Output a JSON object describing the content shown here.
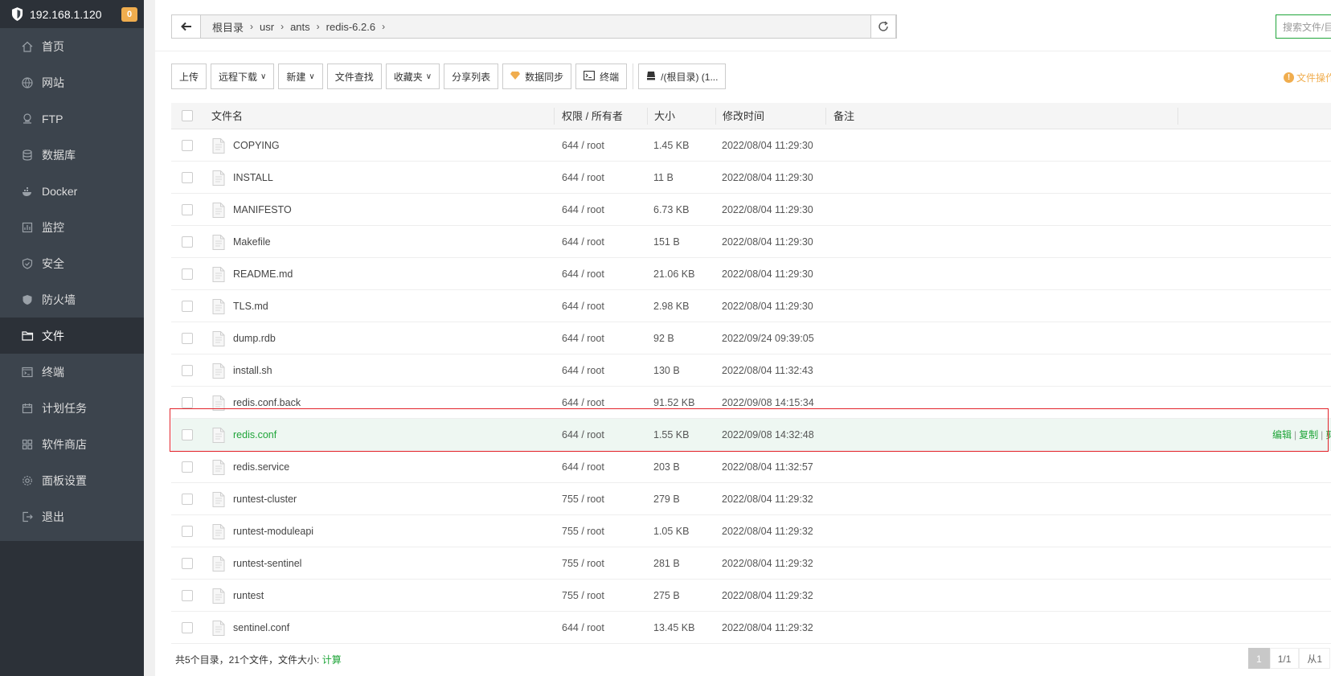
{
  "sidebar": {
    "ip": "192.168.1.120",
    "badge": "0",
    "items": [
      {
        "label": "首页"
      },
      {
        "label": "网站"
      },
      {
        "label": "FTP"
      },
      {
        "label": "数据库"
      },
      {
        "label": "Docker"
      },
      {
        "label": "监控"
      },
      {
        "label": "安全"
      },
      {
        "label": "防火墙"
      },
      {
        "label": "文件"
      },
      {
        "label": "终端"
      },
      {
        "label": "计划任务"
      },
      {
        "label": "软件商店"
      },
      {
        "label": "面板设置"
      },
      {
        "label": "退出"
      }
    ]
  },
  "path": {
    "crumbs": [
      "根目录",
      "usr",
      "ants",
      "redis-6.2.6"
    ]
  },
  "search": {
    "placeholder": "搜索文件/目"
  },
  "toolbar": {
    "upload": "上传",
    "remote_download": "远程下载",
    "new": "新建",
    "find": "文件查找",
    "favorites": "收藏夹",
    "share_list": "分享列表",
    "sync": "数据同步",
    "terminal": "终端",
    "disk": "/(根目录) (1..."
  },
  "ops_label": "文件操作",
  "table": {
    "headers": {
      "name": "文件名",
      "perm": "权限 / 所有者",
      "size": "大小",
      "mtime": "修改时间",
      "note": "备注"
    },
    "rows": [
      {
        "name": "COPYING",
        "perm": "644 / root",
        "size": "1.45 KB",
        "mtime": "2022/08/04 11:29:30"
      },
      {
        "name": "INSTALL",
        "perm": "644 / root",
        "size": "11 B",
        "mtime": "2022/08/04 11:29:30"
      },
      {
        "name": "MANIFESTO",
        "perm": "644 / root",
        "size": "6.73 KB",
        "mtime": "2022/08/04 11:29:30"
      },
      {
        "name": "Makefile",
        "perm": "644 / root",
        "size": "151 B",
        "mtime": "2022/08/04 11:29:30"
      },
      {
        "name": "README.md",
        "perm": "644 / root",
        "size": "21.06 KB",
        "mtime": "2022/08/04 11:29:30"
      },
      {
        "name": "TLS.md",
        "perm": "644 / root",
        "size": "2.98 KB",
        "mtime": "2022/08/04 11:29:30"
      },
      {
        "name": "dump.rdb",
        "perm": "644 / root",
        "size": "92 B",
        "mtime": "2022/09/24 09:39:05"
      },
      {
        "name": "install.sh",
        "perm": "644 / root",
        "size": "130 B",
        "mtime": "2022/08/04 11:32:43"
      },
      {
        "name": "redis.conf.back",
        "perm": "644 / root",
        "size": "91.52 KB",
        "mtime": "2022/09/08 14:15:34"
      },
      {
        "name": "redis.conf",
        "perm": "644 / root",
        "size": "1.55 KB",
        "mtime": "2022/09/08 14:32:48",
        "selected": true
      },
      {
        "name": "redis.service",
        "perm": "644 / root",
        "size": "203 B",
        "mtime": "2022/08/04 11:32:57"
      },
      {
        "name": "runtest-cluster",
        "perm": "755 / root",
        "size": "279 B",
        "mtime": "2022/08/04 11:29:32"
      },
      {
        "name": "runtest-moduleapi",
        "perm": "755 / root",
        "size": "1.05 KB",
        "mtime": "2022/08/04 11:29:32"
      },
      {
        "name": "runtest-sentinel",
        "perm": "755 / root",
        "size": "281 B",
        "mtime": "2022/08/04 11:29:32"
      },
      {
        "name": "runtest",
        "perm": "755 / root",
        "size": "275 B",
        "mtime": "2022/08/04 11:29:32"
      },
      {
        "name": "sentinel.conf",
        "perm": "644 / root",
        "size": "13.45 KB",
        "mtime": "2022/08/04 11:29:32"
      }
    ],
    "row_actions": [
      "编辑",
      "复制",
      "剪切"
    ]
  },
  "footer": {
    "summary": "共5个目录，21个文件，文件大小:",
    "calc": "计算"
  },
  "pager": {
    "current": "1",
    "total": "1/1",
    "from": "从1"
  },
  "colors": {
    "accent": "#20a53a",
    "sidebar": "#3c444d",
    "highlight": "#e3242b",
    "warning": "#f0ad4e"
  }
}
